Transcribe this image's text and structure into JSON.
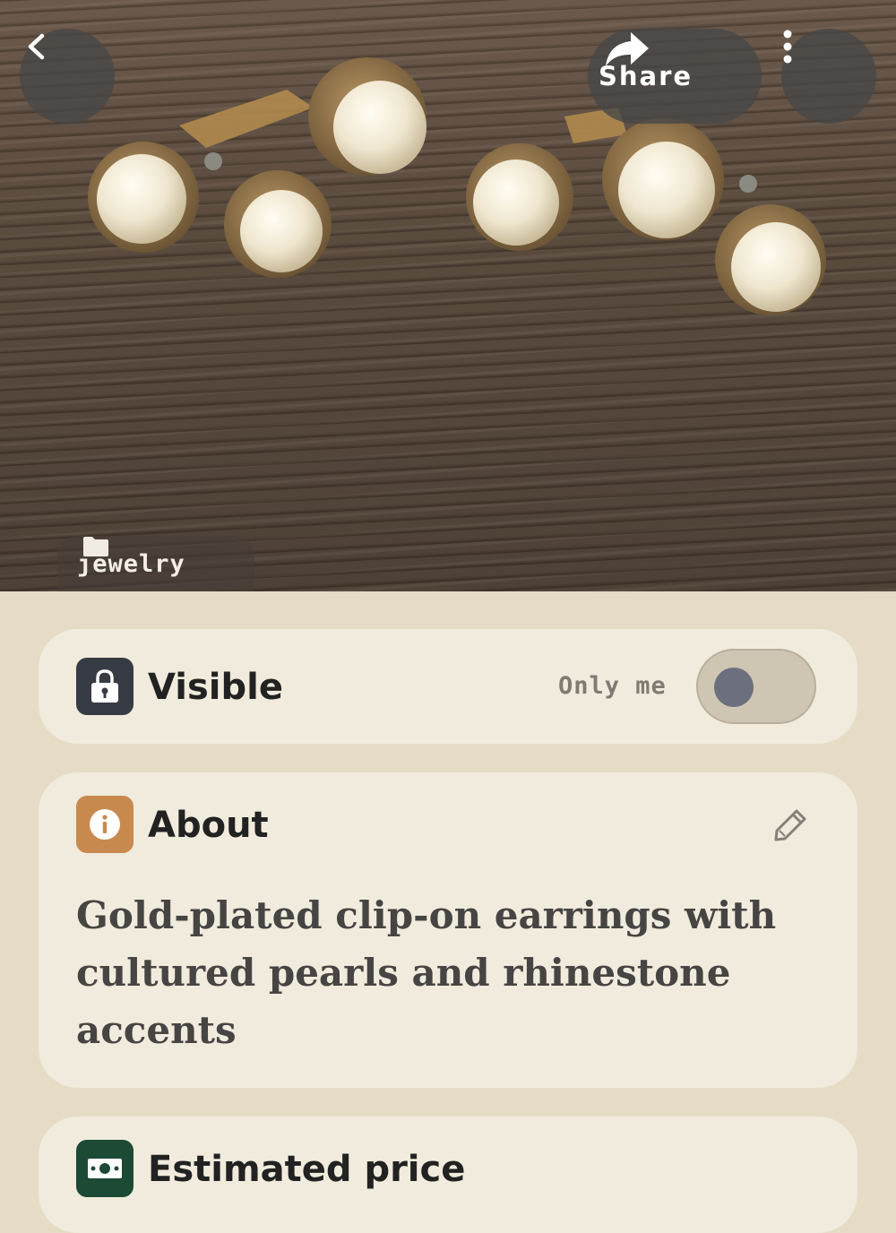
{
  "header": {
    "share_label": "Share",
    "back_icon": "chevron-left-icon",
    "share_icon": "share-arrow-icon",
    "more_icon": "more-vertical-icon"
  },
  "photo": {
    "category": "jewelry",
    "category_icon": "folder-icon"
  },
  "visibility": {
    "title": "Visible",
    "value": "Only me",
    "toggle_on": false,
    "icon": "lock-icon",
    "badge_color": "#373b44"
  },
  "about": {
    "title": "About",
    "description": "Gold-plated clip-on earrings with cultured pearls and rhinestone accents",
    "icon": "info-icon",
    "badge_color": "#c8894f",
    "edit_icon": "pencil-icon"
  },
  "price": {
    "title": "Estimated price",
    "icon": "money-icon",
    "badge_color": "#1c4a34"
  }
}
